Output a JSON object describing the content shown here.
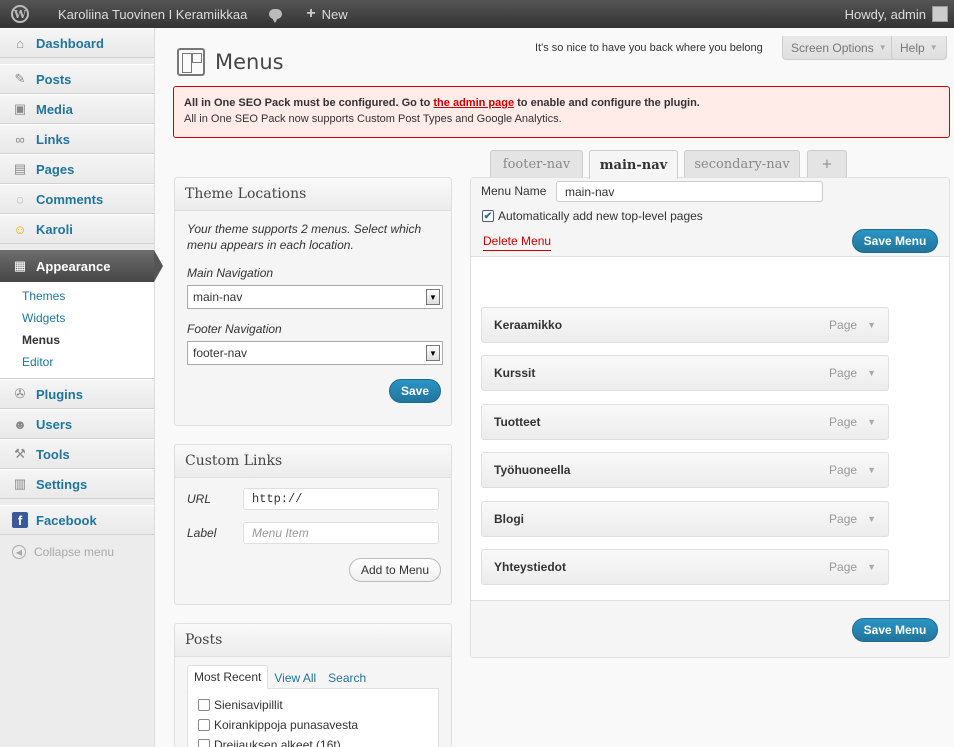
{
  "adminbar": {
    "site_name": "Karoliina Tuovinen I Keramiikkaa",
    "new_label": "New",
    "howdy": "Howdy, admin"
  },
  "sidebar": {
    "items": [
      {
        "label": "Dashboard",
        "icon": "⌂"
      },
      {
        "label": "Posts",
        "icon": "✎"
      },
      {
        "label": "Media",
        "icon": "▣"
      },
      {
        "label": "Links",
        "icon": "∞"
      },
      {
        "label": "Pages",
        "icon": "▤"
      },
      {
        "label": "Comments",
        "icon": "◌"
      },
      {
        "label": "Karoli",
        "icon": "☺"
      },
      {
        "label": "Appearance",
        "icon": "▦"
      },
      {
        "label": "Plugins",
        "icon": "✇"
      },
      {
        "label": "Users",
        "icon": "☻"
      },
      {
        "label": "Tools",
        "icon": "⚒"
      },
      {
        "label": "Settings",
        "icon": "▥"
      },
      {
        "label": "Facebook",
        "icon": "f"
      }
    ],
    "submenu": [
      "Themes",
      "Widgets",
      "Menus",
      "Editor"
    ],
    "collapse_label": "Collapse menu"
  },
  "header": {
    "title": "Menus",
    "dolly": "It's so nice to have you back where you belong",
    "screen_options": "Screen Options",
    "help": "Help"
  },
  "notice": {
    "line1_pre": "All in One SEO Pack must be configured. Go to",
    "line1_link": "the admin page",
    "line1_post": "to enable and configure the plugin.",
    "line2": "All in One SEO Pack now supports Custom Post Types and Google Analytics."
  },
  "theme_locations": {
    "title": "Theme Locations",
    "description": "Your theme supports 2 menus. Select which menu appears in each location.",
    "main_label": "Main Navigation",
    "main_value": "main-nav",
    "footer_label": "Footer Navigation",
    "footer_value": "footer-nav",
    "save_label": "Save"
  },
  "custom_links": {
    "title": "Custom Links",
    "url_label": "URL",
    "url_value": "http://",
    "label_label": "Label",
    "label_placeholder": "Menu Item",
    "add_label": "Add to Menu"
  },
  "posts_box": {
    "title": "Posts",
    "tabs": [
      "Most Recent",
      "View All",
      "Search"
    ],
    "items": [
      "Sienisavipillit",
      "Koirankippoja punasavesta",
      "Dreijauksen alkeet (16t)"
    ]
  },
  "menu_tabs": [
    "footer-nav",
    "main-nav",
    "secondary-nav",
    "+"
  ],
  "menu_editor": {
    "name_label": "Menu Name",
    "name_value": "main-nav",
    "auto_add_label": "Automatically add new top-level pages",
    "delete_label": "Delete Menu",
    "save_label": "Save Menu",
    "items": [
      {
        "title": "Keraamikko",
        "type": "Page"
      },
      {
        "title": "Kurssit",
        "type": "Page"
      },
      {
        "title": "Tuotteet",
        "type": "Page"
      },
      {
        "title": "Työhuoneella",
        "type": "Page"
      },
      {
        "title": "Blogi",
        "type": "Page"
      },
      {
        "title": "Yhteystiedot",
        "type": "Page"
      }
    ]
  },
  "colors": {
    "link": "#21759b",
    "notice_border": "#cc0000",
    "notice_bg": "#ffebe8",
    "primary_button": "#21759b"
  }
}
